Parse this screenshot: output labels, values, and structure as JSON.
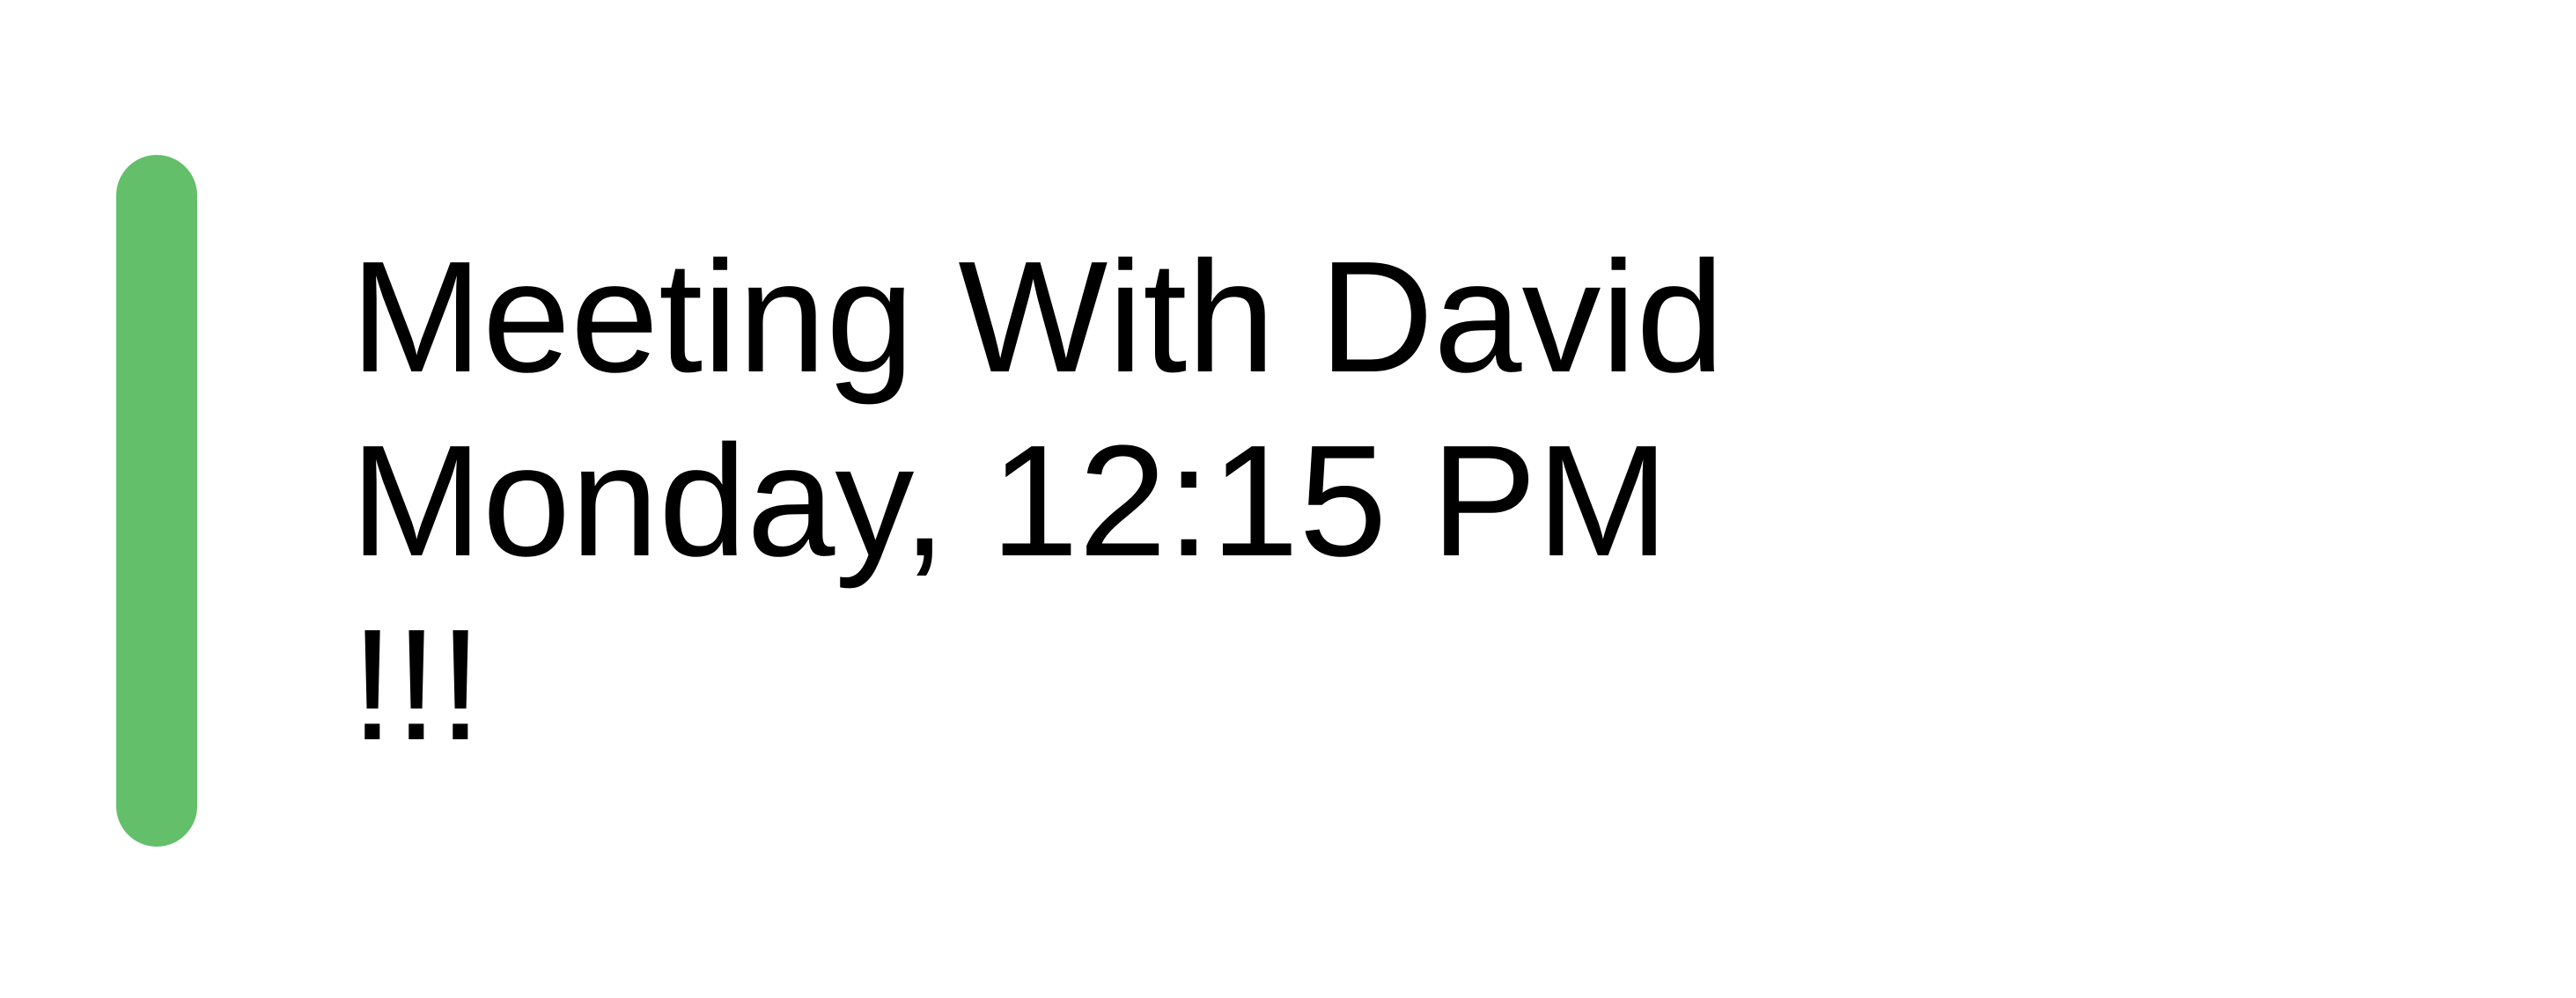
{
  "event": {
    "title": "Meeting With David",
    "datetime": "Monday, 12:15 PM",
    "priority": "!!!"
  },
  "colors": {
    "accent": "#64bf6a",
    "text": "#000000",
    "background": "#ffffff"
  }
}
